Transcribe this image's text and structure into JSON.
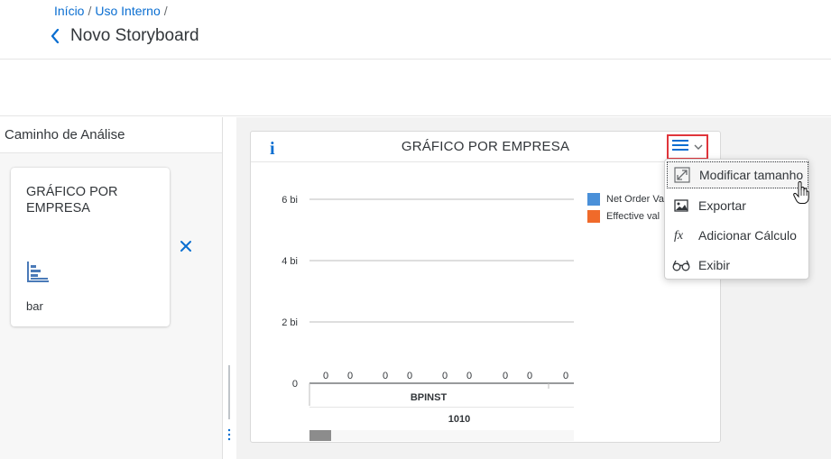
{
  "header": {
    "breadcrumb": [
      "Início",
      "Uso Interno"
    ],
    "breadcrumb_separator": "/",
    "title": "Novo Storyboard"
  },
  "left_panel": {
    "title": "Caminho de Análise",
    "tile": {
      "title": "GRÁFICO POR EMPRESA",
      "icon": "bar-chart-icon",
      "subtitle": "bar"
    },
    "remove_icon": "close-icon"
  },
  "chart_card": {
    "info_icon": "i",
    "title": "GRÁFICO POR EMPRESA",
    "menu_icon": "hamburger-menu-icon"
  },
  "chart_data": {
    "type": "bar",
    "categories": [
      "BPINST"
    ],
    "group_label": "1010",
    "series": [
      {
        "name": "Net Order Va",
        "color": "#4a90d9",
        "values": [
          0,
          0,
          0,
          0,
          0
        ]
      },
      {
        "name": "Effective val",
        "color": "#f06a2a",
        "values": [
          0,
          0,
          0,
          0
        ]
      }
    ],
    "bar_value_labels": [
      "0",
      "0",
      "0",
      "0",
      "0",
      "0",
      "0",
      "0",
      "0"
    ],
    "y_ticks": [
      "6 bi",
      "4 bi",
      "2 bi",
      "0"
    ],
    "ylim": [
      0,
      6000000000
    ],
    "grid": true,
    "legend_position": "right"
  },
  "dropdown": {
    "items": [
      {
        "label": "Modificar tamanho",
        "icon": "resize-icon"
      },
      {
        "label": "Exportar",
        "icon": "export-image-icon"
      },
      {
        "label": "Adicionar Cálculo",
        "icon": "function-icon"
      },
      {
        "label": "Exibir",
        "icon": "glasses-icon"
      }
    ]
  },
  "colors": {
    "accent": "#0a6ed1",
    "highlight_border": "#e0353b",
    "series_1": "#4a90d9",
    "series_2": "#f06a2a"
  }
}
